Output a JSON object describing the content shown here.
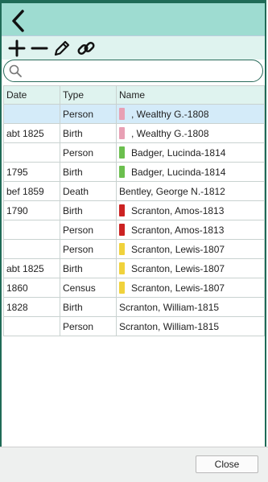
{
  "search": {
    "value": "",
    "placeholder": ""
  },
  "table": {
    "headers": [
      "Date",
      "Type",
      "Name"
    ],
    "rows": [
      {
        "date": "",
        "type": "Person",
        "name": ", Wealthy G.-1808",
        "color": "#e8a0b4",
        "selected": true
      },
      {
        "date": "abt 1825",
        "type": "Birth",
        "name": ", Wealthy G.-1808",
        "color": "#e8a0b4"
      },
      {
        "date": "",
        "type": "Person",
        "name": "Badger, Lucinda-1814",
        "color": "#6bbf4e"
      },
      {
        "date": "1795",
        "type": "Birth",
        "name": "Badger, Lucinda-1814",
        "color": "#6bbf4e"
      },
      {
        "date": "bef 1859",
        "type": "Death",
        "name": "Bentley, George N.-1812",
        "color": ""
      },
      {
        "date": "1790",
        "type": "Birth",
        "name": "Scranton, Amos-1813",
        "color": "#cc2222"
      },
      {
        "date": "",
        "type": "Person",
        "name": "Scranton, Amos-1813",
        "color": "#cc2222"
      },
      {
        "date": "",
        "type": "Person",
        "name": "Scranton, Lewis-1807",
        "color": "#f0d23c"
      },
      {
        "date": "abt 1825",
        "type": "Birth",
        "name": "Scranton, Lewis-1807",
        "color": "#f0d23c"
      },
      {
        "date": "1860",
        "type": "Census",
        "name": "Scranton, Lewis-1807",
        "color": "#f0d23c"
      },
      {
        "date": "1828",
        "type": "Birth",
        "name": "Scranton, William-1815",
        "color": ""
      },
      {
        "date": "",
        "type": "Person",
        "name": "Scranton, William-1815",
        "color": ""
      }
    ]
  },
  "footer": {
    "close_label": "Close"
  },
  "colors": {
    "topbar": "#9edcd1",
    "toolbar": "#dff3ef",
    "frame": "#1f6b57",
    "selected_row": "#d4ebf9"
  }
}
